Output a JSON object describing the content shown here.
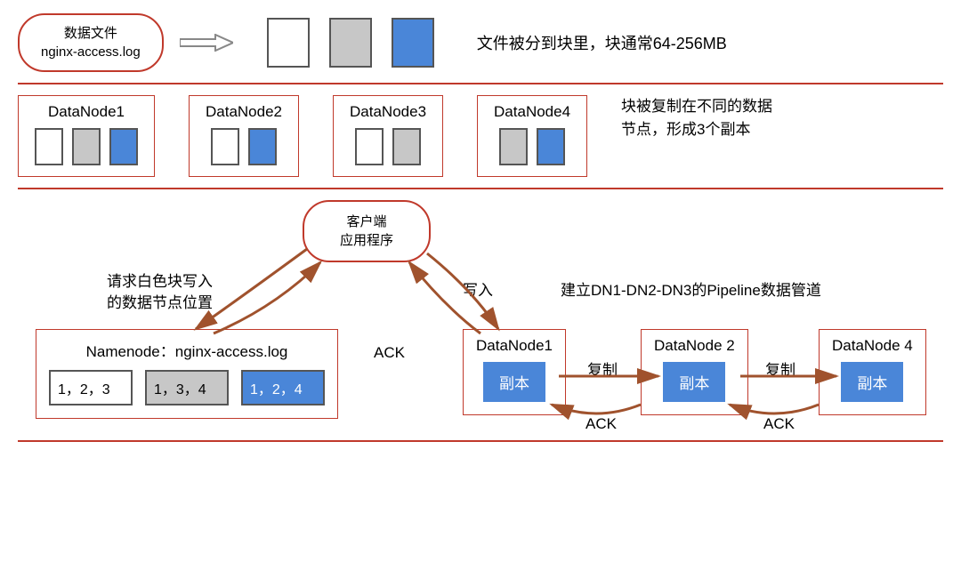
{
  "section1": {
    "bubble_line1": "数据文件",
    "bubble_line2": "nginx-access.log",
    "caption": "文件被分到块里，块通常64-256MB"
  },
  "section2": {
    "dn1": "DataNode1",
    "dn2": "DataNode2",
    "dn3": "DataNode3",
    "dn4": "DataNode4",
    "caption": "块被复制在不同的数据节点，形成3个副本"
  },
  "section3": {
    "client_line1": "客户端",
    "client_line2": "应用程序",
    "req_line1": "请求白色块写入",
    "req_line2": "的数据节点位置",
    "namenode_title": "Namenode：nginx-access.log",
    "nn_white": "1，2，3",
    "nn_grey": "1，3，4",
    "nn_blue": "1，2，4",
    "write": "写入",
    "ack": "ACK",
    "pipeline": "建立DN1-DN2-DN3的Pipeline数据管道",
    "pdn1": "DataNode1",
    "pdn2": "DataNode 2",
    "pdn3": "DataNode 4",
    "replica": "副本",
    "copy": "复制"
  }
}
